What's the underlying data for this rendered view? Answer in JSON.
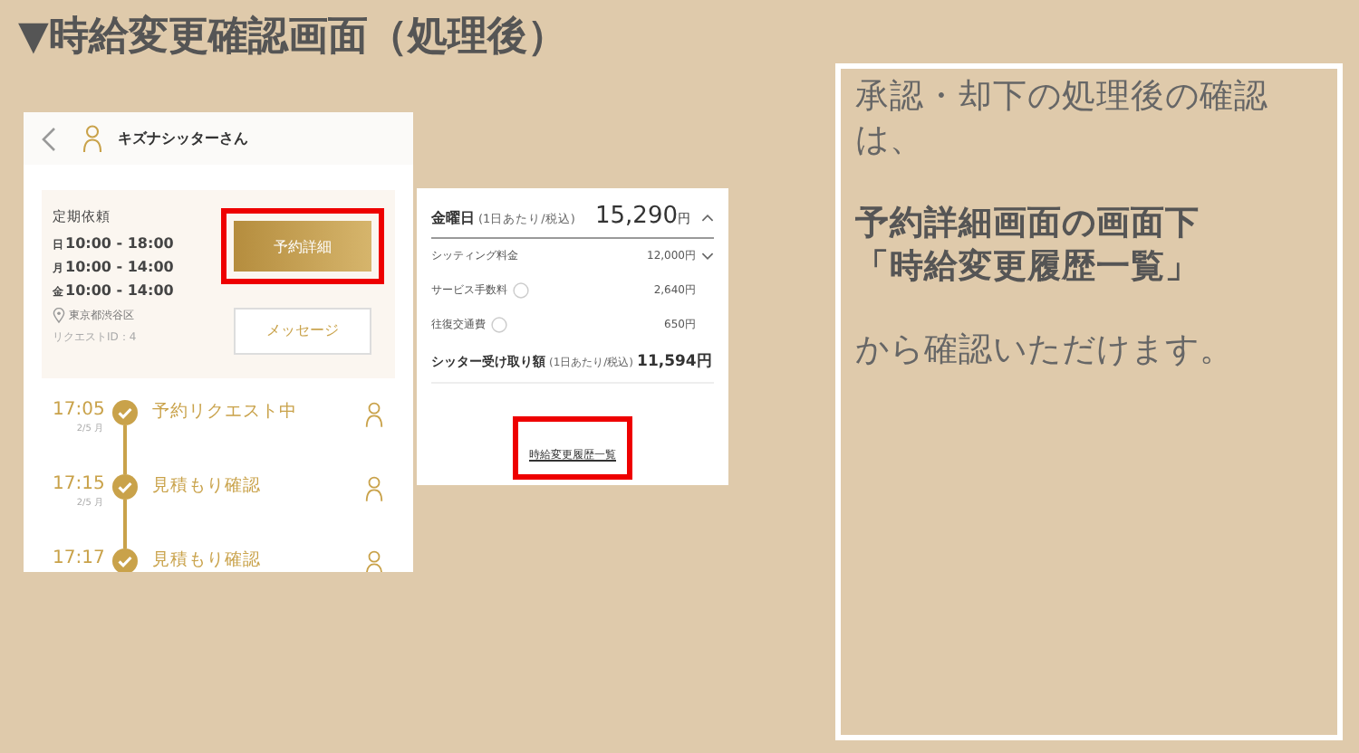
{
  "title": "▼時給変更確認画面（処理後）",
  "app_screen": {
    "header_title": "キズナシッターさん",
    "request": {
      "heading": "定期依頼",
      "schedule": [
        {
          "day": "日",
          "time": "10:00 - 18:00"
        },
        {
          "day": "月",
          "time": "10:00 - 14:00"
        },
        {
          "day": "金",
          "time": "10:00 - 14:00"
        }
      ],
      "location": "東京都渋谷区",
      "request_id": "リクエストID：4"
    },
    "buttons": [
      {
        "label": "予約詳細",
        "kind": "primary",
        "highlighted": true
      },
      {
        "label": "メッセージ",
        "kind": "outline",
        "highlighted": false
      }
    ],
    "timeline": [
      {
        "time": "17:05",
        "date": "2/5 月",
        "label": "予約リクエスト中"
      },
      {
        "time": "17:15",
        "date": "2/5 月",
        "label": "見積もり確認"
      },
      {
        "time": "17:17",
        "label": "見積もり確認"
      }
    ]
  },
  "price_card": {
    "day": "金曜日",
    "day_note": "(1日あたり/税込)",
    "total": "15,290",
    "unit": "円",
    "items": [
      {
        "label": "シッティング料金",
        "amount": "12,000円",
        "help": false,
        "expand": true
      },
      {
        "label": "サービス手数料",
        "amount": "2,640円",
        "help": true,
        "expand": false
      },
      {
        "label": "往復交通費",
        "amount": "650円",
        "help": true,
        "expand": false
      }
    ],
    "receive": {
      "label": "シッター受け取り額",
      "note": "(1日あたり/税込)",
      "amount": "11,594円"
    },
    "link": {
      "label": "時給変更履歴一覧",
      "highlighted": true
    }
  },
  "note": {
    "paragraphs": [
      {
        "lines": [
          "承認・却下の処理後の確認は、"
        ],
        "bold": false
      },
      {
        "lines": [
          "予約詳細画面の画面下",
          "「時給変更履歴一覧」"
        ],
        "bold": true
      },
      {
        "lines": [
          "から確認いただけます。"
        ],
        "bold": false
      }
    ]
  }
}
